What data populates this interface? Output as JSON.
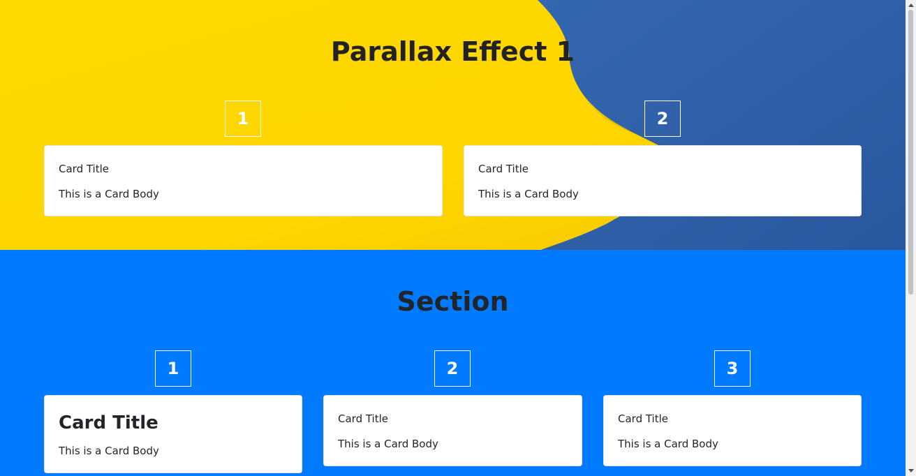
{
  "hero": {
    "title": "Parallax Effect 1",
    "boxes": [
      "1",
      "2"
    ],
    "cards": [
      {
        "title": "Card Title",
        "body": "This is a Card Body"
      },
      {
        "title": "Card Title",
        "body": "This is a Card Body"
      }
    ],
    "colors": {
      "yellow": "#ffd600",
      "blue": "#2d5da6"
    }
  },
  "section": {
    "title": "Section",
    "boxes": [
      "1",
      "2",
      "3"
    ],
    "cards": [
      {
        "title": "Card Title",
        "body": "This is a Card Body"
      },
      {
        "title": "Card Title",
        "body": "This is a Card Body"
      },
      {
        "title": "Card Title",
        "body": "This is a Card Body"
      }
    ],
    "colors": {
      "background": "#007bff"
    }
  }
}
